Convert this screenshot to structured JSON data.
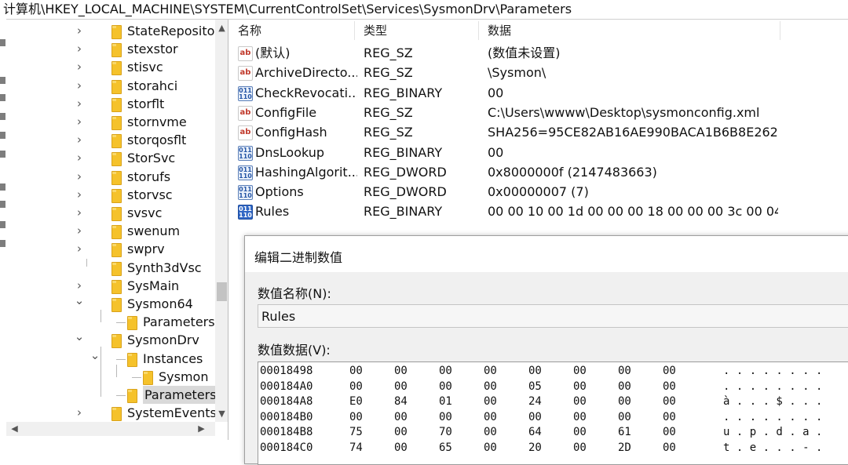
{
  "address_bar": {
    "path": "计算机\\HKEY_LOCAL_MACHINE\\SYSTEM\\CurrentControlSet\\Services\\SysmonDrv\\Parameters"
  },
  "tree": {
    "items": [
      {
        "label": "StateReposito",
        "depth": 0,
        "expander": "collapsed"
      },
      {
        "label": "stexstor",
        "depth": 0,
        "expander": "collapsed"
      },
      {
        "label": "stisvc",
        "depth": 0,
        "expander": "collapsed"
      },
      {
        "label": "storahci",
        "depth": 0,
        "expander": "collapsed"
      },
      {
        "label": "storflt",
        "depth": 0,
        "expander": "collapsed"
      },
      {
        "label": "stornvme",
        "depth": 0,
        "expander": "collapsed"
      },
      {
        "label": "storqosflt",
        "depth": 0,
        "expander": "collapsed"
      },
      {
        "label": "StorSvc",
        "depth": 0,
        "expander": "collapsed"
      },
      {
        "label": "storufs",
        "depth": 0,
        "expander": "collapsed"
      },
      {
        "label": "storvsc",
        "depth": 0,
        "expander": "collapsed"
      },
      {
        "label": "svsvc",
        "depth": 0,
        "expander": "collapsed"
      },
      {
        "label": "swenum",
        "depth": 0,
        "expander": "collapsed"
      },
      {
        "label": "swprv",
        "depth": 0,
        "expander": "collapsed"
      },
      {
        "label": "Synth3dVsc",
        "depth": 0,
        "expander": "none"
      },
      {
        "label": "SysMain",
        "depth": 0,
        "expander": "collapsed"
      },
      {
        "label": "Sysmon64",
        "depth": 0,
        "expander": "expanded"
      },
      {
        "label": "Parameters",
        "depth": 1,
        "expander": "none"
      },
      {
        "label": "SysmonDrv",
        "depth": 0,
        "expander": "expanded"
      },
      {
        "label": "Instances",
        "depth": 1,
        "expander": "expanded"
      },
      {
        "label": "Sysmon",
        "depth": 2,
        "expander": "none"
      },
      {
        "label": "Parameters",
        "depth": 1,
        "expander": "none",
        "selected": true
      },
      {
        "label": "SystemEvents",
        "depth": 0,
        "expander": "collapsed"
      }
    ]
  },
  "values_table": {
    "columns": [
      "名称",
      "类型",
      "数据"
    ],
    "rows": [
      {
        "name": "(默认)",
        "type": "REG_SZ",
        "data": "(数值未设置)",
        "icon": "string-value-icon",
        "icon_text": "ab"
      },
      {
        "name": "ArchiveDirecto...",
        "type": "REG_SZ",
        "data": "\\Sysmon\\",
        "icon": "string-value-icon",
        "icon_text": "ab"
      },
      {
        "name": "CheckRevocati...",
        "type": "REG_BINARY",
        "data": "00",
        "icon": "binary-value-icon",
        "icon_text": "011\n110"
      },
      {
        "name": "ConfigFile",
        "type": "REG_SZ",
        "data": "C:\\Users\\wwww\\Desktop\\sysmonconfig.xml",
        "icon": "string-value-icon",
        "icon_text": "ab"
      },
      {
        "name": "ConfigHash",
        "type": "REG_SZ",
        "data": "SHA256=95CE82AB16AE990BACA1B6B8E262...",
        "icon": "string-value-icon",
        "icon_text": "ab"
      },
      {
        "name": "DnsLookup",
        "type": "REG_BINARY",
        "data": "00",
        "icon": "binary-value-icon",
        "icon_text": "011\n110"
      },
      {
        "name": "HashingAlgorit...",
        "type": "REG_DWORD",
        "data": "0x8000000f (2147483663)",
        "icon": "binary-value-icon",
        "icon_text": "011\n110"
      },
      {
        "name": "Options",
        "type": "REG_DWORD",
        "data": "0x00000007 (7)",
        "icon": "binary-value-icon",
        "icon_text": "011\n110"
      },
      {
        "name": "Rules",
        "type": "REG_BINARY",
        "data": "00 00 10 00 1d 00 00 00 18 00 00 00 3c 00 04 ...",
        "icon": "binary-value-icon",
        "icon_text": "011\n110",
        "selected": true
      }
    ]
  },
  "dialog": {
    "title": "编辑二进制数值",
    "value_name_label": "数值名称(N):",
    "value_name": "Rules",
    "value_data_label": "数值数据(V):",
    "hex_rows": [
      {
        "offset": "00018498",
        "bytes": [
          "00",
          "00",
          "00",
          "00",
          "00",
          "00",
          "00",
          "00"
        ],
        "ascii": ". . . . . . . ."
      },
      {
        "offset": "000184A0",
        "bytes": [
          "00",
          "00",
          "00",
          "00",
          "05",
          "00",
          "00",
          "00"
        ],
        "ascii": ". . . . . . . ."
      },
      {
        "offset": "000184A8",
        "bytes": [
          "E0",
          "84",
          "01",
          "00",
          "24",
          "00",
          "00",
          "00"
        ],
        "ascii": "à . . . $ . . ."
      },
      {
        "offset": "000184B0",
        "bytes": [
          "00",
          "00",
          "00",
          "00",
          "00",
          "00",
          "00",
          "00"
        ],
        "ascii": ". . . . . . . ."
      },
      {
        "offset": "000184B8",
        "bytes": [
          "75",
          "00",
          "70",
          "00",
          "64",
          "00",
          "61",
          "00"
        ],
        "ascii": "u . p . d . a ."
      },
      {
        "offset": "000184C0",
        "bytes": [
          "74",
          "00",
          "65",
          "00",
          "20",
          "00",
          "2D",
          "00"
        ],
        "ascii": "t . e . . . - ."
      }
    ]
  },
  "scrollbars": {
    "up": "▲",
    "down": "▼",
    "left": "◀",
    "right": "▶"
  }
}
